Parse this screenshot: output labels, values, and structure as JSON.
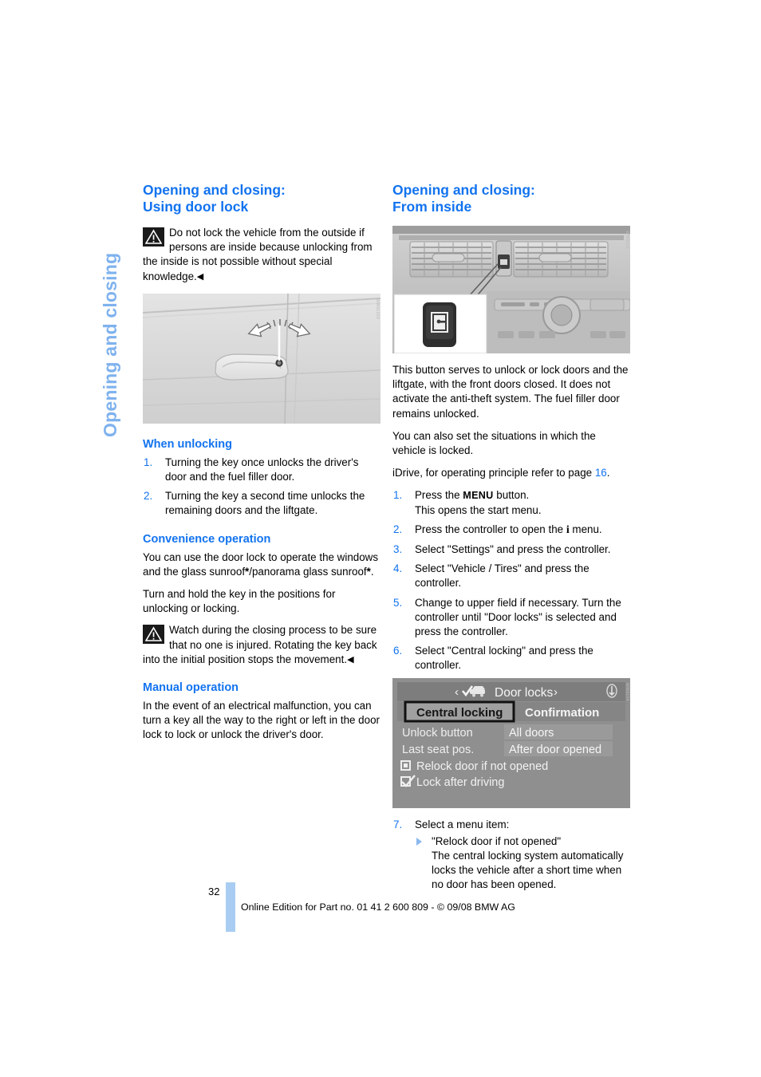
{
  "chapter_tab": "Opening and closing",
  "left_column": {
    "heading": "Opening and closing:\nUsing door lock",
    "warning1": {
      "icon": "warning-triangle-icon",
      "text": "Do not lock the vehicle from the outside if persons are inside because unlocking from the inside is not possible without special knowledge.",
      "endmark": "◀"
    },
    "figure_handle": {
      "alt": "door-handle-with-lock-cylinder-photo",
      "code": "WW91009"
    },
    "when_unlocking": {
      "heading": "When unlocking",
      "steps": [
        {
          "num": "1.",
          "text": "Turning the key once unlocks the driver's door and the fuel filler door."
        },
        {
          "num": "2.",
          "text": "Turning the key a second time unlocks the remaining doors and the liftgate."
        }
      ]
    },
    "convenience": {
      "heading": "Convenience operation",
      "para1": "You can use the door lock to operate the windows and the glass sunroof*/panorama glass sunroof*.",
      "para2": "Turn and hold the key in the positions for unlocking or locking."
    },
    "warning2": {
      "icon": "warning-triangle-icon",
      "text": "Watch during the closing process to be sure that no one is injured. Rotating the key back into the initial position stops the movement.",
      "endmark": "◀"
    },
    "manual": {
      "heading": "Manual operation",
      "para1": "In the event of an electrical malfunction, you can turn a key all the way to the right or left in the door lock to lock or unlock the driver's door."
    }
  },
  "right_column": {
    "heading": "Opening and closing:\nFrom inside",
    "figure_dash": {
      "alt": "dashboard-center-vents-with-central-locking-button-photo",
      "code": "WW9103"
    },
    "para1": "This button serves to unlock or lock doors and the liftgate, with the front doors closed. It does not activate the anti-theft system. The fuel filler door remains unlocked.",
    "para2": "You can also set the situations in which the vehicle is locked.",
    "idrive_note_prefix": "iDrive, for operating principle refer to page ",
    "idrive_note_page": "16",
    "idrive_note_suffix": ".",
    "steps": [
      {
        "num": "1.",
        "text_prefix": "Press the ",
        "key": "MENU",
        "text_suffix": " button.",
        "line2": "This opens the start menu."
      },
      {
        "num": "2.",
        "text_prefix": "Press the controller to open the ",
        "key": "i",
        "text_suffix": " menu."
      },
      {
        "num": "3.",
        "text": "Select \"Settings\" and press the controller."
      },
      {
        "num": "4.",
        "text": "Select \"Vehicle / Tires\" and press the controller."
      },
      {
        "num": "5.",
        "text": "Change to upper field if necessary. Turn the controller until \"Door locks\" is selected and press the controller."
      },
      {
        "num": "6.",
        "text": "Select \"Central locking\" and press the controller."
      }
    ],
    "idrive_screen": {
      "title": "Door locks",
      "left_arrow": "‹",
      "right_arrow": "›",
      "tabs": [
        {
          "label": "Central locking",
          "selected": true
        },
        {
          "label": "Confirmation",
          "selected": false
        }
      ],
      "rows": [
        {
          "label": "Unlock button",
          "value": "All doors"
        },
        {
          "label": "Last seat pos.",
          "value": "After door opened"
        }
      ],
      "checkboxes": [
        {
          "label": "Relock door if not opened",
          "checked": false
        },
        {
          "label": "Lock after driving",
          "checked": true
        }
      ],
      "code": "WW9104"
    },
    "step7": {
      "num": "7.",
      "text": "Select a menu item:",
      "sub": {
        "title": "\"Relock door if not opened\"",
        "body": "The central locking system automatically locks the vehicle after a short time when no door has been opened."
      }
    }
  },
  "footer": {
    "page_number": "32",
    "text": "Online Edition for Part no. 01 41 2 600 809 - © 09/08 BMW AG"
  }
}
